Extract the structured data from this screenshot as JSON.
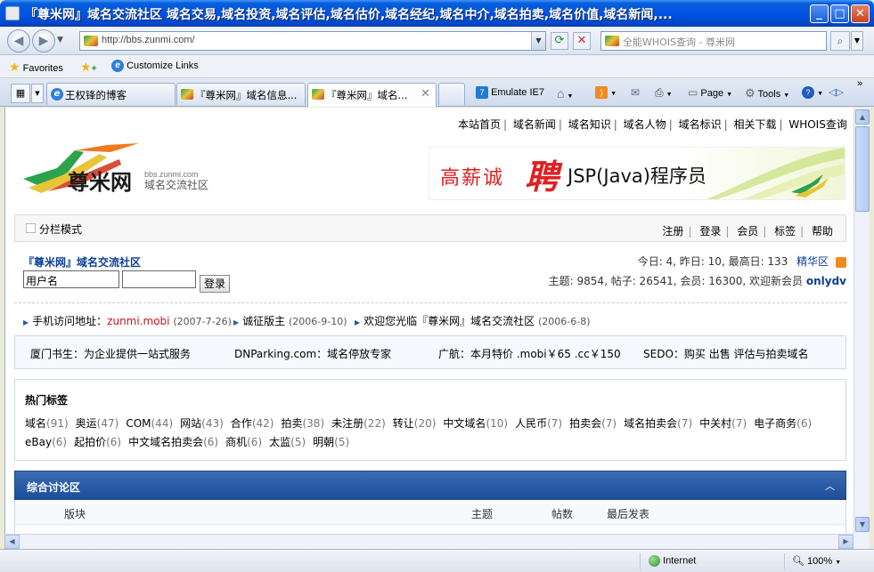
{
  "window": {
    "title": "『尊米网』域名交流社区 域名交易,域名投资,域名评估,域名估价,域名经纪,域名中介,域名拍卖,域名价值,域名新闻,..."
  },
  "address_bar": {
    "url": "http://bbs.zunmi.com/",
    "search_placeholder": "全能WHOIS查询 - 尊米网"
  },
  "favorites_bar": {
    "favorites_label": "Favorites",
    "customize_label": "Customize Links"
  },
  "tabs": [
    {
      "label": "王权锋的博客",
      "active": false
    },
    {
      "label": "『尊米网』域名信息...",
      "active": false
    },
    {
      "label": "『尊米网』域名...",
      "active": true
    }
  ],
  "command_bar": {
    "emulate": "Emulate IE7",
    "page": "Page",
    "tools": "Tools"
  },
  "page": {
    "top_nav": [
      "本站首页",
      "域名新闻",
      "域名知识",
      "域名人物",
      "域名标识",
      "相关下载",
      "WHOIS查询"
    ],
    "logo_text": "尊米网",
    "logo_sub_url": "bbs.zunmi.com",
    "logo_sub_text": "域名交流社区",
    "banner": {
      "part1": "高薪诚",
      "part2": "聘",
      "part3": "JSP(Java)程序员"
    },
    "mode_label": "分栏模式",
    "user_nav": [
      "注册",
      "登录",
      "会员",
      "标签",
      "帮助"
    ],
    "forum_title": "『尊米网』域名交流社区",
    "login": {
      "username_value": "用户名",
      "button": "登录"
    },
    "stats_line1": "今日: 4, 昨日: 10, 最高日: 133",
    "stats_line1_link": "精华区",
    "stats_line2": "主题: 9854, 帖子: 26541, 会员: 16300, 欢迎新会员",
    "stats_newest_member": "onlydv",
    "announcements": [
      {
        "text": "手机访问地址：",
        "highlight": "zunmi.mobi",
        "date": "(2007-7-26)"
      },
      {
        "text": "诚征版主",
        "highlight": "",
        "date": "(2006-9-10)"
      },
      {
        "text": "欢迎您光临『尊米网』域名交流社区",
        "highlight": "",
        "date": "(2006-6-8)"
      }
    ],
    "ads": [
      "厦门书生：为企业提供一站式服务",
      "DNParking.com：域名停放专家",
      "广航：本月特价 .mobi￥65 .cc￥150",
      "SEDO：购买 出售 评估与拍卖域名"
    ],
    "hot_tags_title": "热门标签",
    "hot_tags_row1": [
      {
        "t": "域名",
        "n": "(91)"
      },
      {
        "t": "奥运",
        "n": "(47)"
      },
      {
        "t": "COM",
        "n": "(44)"
      },
      {
        "t": "网站",
        "n": "(43)"
      },
      {
        "t": "合作",
        "n": "(42)"
      },
      {
        "t": "拍卖",
        "n": "(38)"
      },
      {
        "t": "未注册",
        "n": "(22)"
      },
      {
        "t": "转让",
        "n": "(20)"
      },
      {
        "t": "中文域名",
        "n": "(10)"
      },
      {
        "t": "人民币",
        "n": "(7)"
      },
      {
        "t": "拍卖会",
        "n": "(7)"
      },
      {
        "t": "域名拍卖会",
        "n": "(7)"
      },
      {
        "t": "中关村",
        "n": "(7)"
      },
      {
        "t": "电子商务",
        "n": "(6)"
      }
    ],
    "hot_tags_row2": [
      {
        "t": "eBay",
        "n": "(6)"
      },
      {
        "t": "起拍价",
        "n": "(6)"
      },
      {
        "t": "中文域名拍卖会",
        "n": "(6)"
      },
      {
        "t": "商机",
        "n": "(6)"
      },
      {
        "t": "太监",
        "n": "(5)"
      },
      {
        "t": "明朝",
        "n": "(5)"
      }
    ],
    "category_title": "综合讨论区",
    "columns": {
      "board": "版块",
      "topics": "主题",
      "posts": "帖数",
      "last_post": "最后发表"
    }
  },
  "status_bar": {
    "zone": "Internet",
    "zoom": "100%"
  }
}
